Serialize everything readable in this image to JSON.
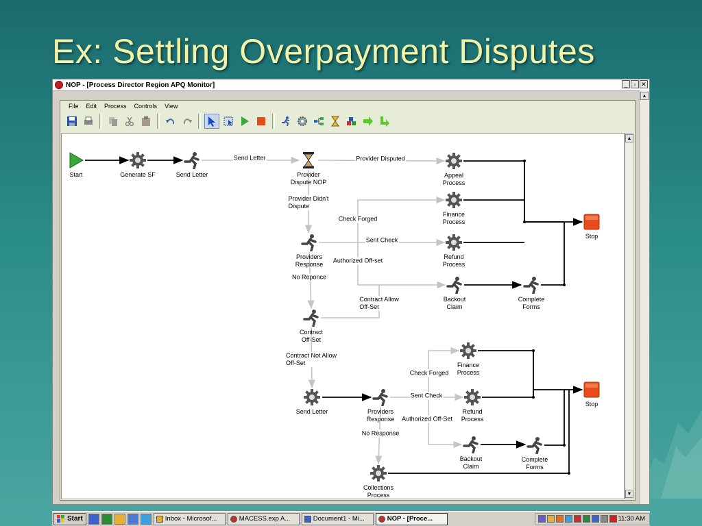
{
  "slide": {
    "title": "Ex: Settling Overpayment Disputes"
  },
  "window": {
    "title": "NOP - [Process Director Region APQ Monitor]"
  },
  "menu": {
    "items": [
      "File",
      "Edit",
      "Process",
      "Controls",
      "View"
    ]
  },
  "toolbar": {
    "groups": [
      [
        "save-icon",
        "print-icon"
      ],
      [
        "copy-icon",
        "cut-icon",
        "paste-icon"
      ],
      [
        "undo-icon",
        "redo-icon"
      ],
      [
        "pointer-icon",
        "select-area-icon",
        "start-node-icon",
        "stop-node-icon"
      ],
      [
        "task-runner-icon",
        "gear-icon",
        "connector-icon",
        "hourglass-icon",
        "cubes-icon",
        "arrow-right-icon",
        "arrow-corner-icon"
      ]
    ]
  },
  "diagram": {
    "nodes": [
      {
        "id": "start",
        "type": "start",
        "label": "Start"
      },
      {
        "id": "generate-sf",
        "type": "gear",
        "label": "Generate SF"
      },
      {
        "id": "send-letter-1",
        "type": "runner",
        "label": "Send Letter"
      },
      {
        "id": "provider-dispute-nop",
        "type": "hourglass",
        "label": "Provider\nDispute NOP"
      },
      {
        "id": "appeal-process",
        "type": "gear",
        "label": "Appeal\nProcess"
      },
      {
        "id": "finance-process-1",
        "type": "gear",
        "label": "Finance\nProcess"
      },
      {
        "id": "refund-process-1",
        "type": "gear",
        "label": "Refund\nProcess"
      },
      {
        "id": "providers-response-1",
        "type": "runner",
        "label": "Providers\nResponse"
      },
      {
        "id": "backout-claim-1",
        "type": "runner",
        "label": "Backout\nClaim"
      },
      {
        "id": "complete-forms-1",
        "type": "runner",
        "label": "Complete\nForms"
      },
      {
        "id": "stop-1",
        "type": "stop",
        "label": "Stop"
      },
      {
        "id": "contract-off-set",
        "type": "runner",
        "label": "Contract\nOff-Set"
      },
      {
        "id": "send-letter-2",
        "type": "gear",
        "label": "Send Letter"
      },
      {
        "id": "providers-response-2",
        "type": "runner",
        "label": "Providers\nResponse"
      },
      {
        "id": "finance-process-2",
        "type": "gear",
        "label": "Finance\nProcess"
      },
      {
        "id": "refund-process-2",
        "type": "gear",
        "label": "Refund\nProcess"
      },
      {
        "id": "backout-claim-2",
        "type": "runner",
        "label": "Backout\nClaim"
      },
      {
        "id": "complete-forms-2",
        "type": "runner",
        "label": "Complete\nForms"
      },
      {
        "id": "stop-2",
        "type": "stop",
        "label": "Stop"
      },
      {
        "id": "collections-process",
        "type": "gear",
        "label": "Collections\nProcess"
      }
    ],
    "edge_labels": [
      {
        "id": "send-letter",
        "text": "Send Letter"
      },
      {
        "id": "provider-disputed",
        "text": "Provider Disputed"
      },
      {
        "id": "provider-didnt-dispute",
        "text": "Provider Didn't\nDispute"
      },
      {
        "id": "check-forged-1",
        "text": "Check Forged"
      },
      {
        "id": "sent-check-1",
        "text": "Sent Check"
      },
      {
        "id": "authorized-off-set-1",
        "text": "Authorized Off-set"
      },
      {
        "id": "no-reponce",
        "text": "No Reponce"
      },
      {
        "id": "contract-allow-off-set",
        "text": "Contract Allow\nOff-Set"
      },
      {
        "id": "contract-not-allow-off-set",
        "text": "Contract Not Allow\nOff-Set"
      },
      {
        "id": "check-forged-2",
        "text": "Check Forged"
      },
      {
        "id": "sent-check-2",
        "text": "Sent Check"
      },
      {
        "id": "authorized-off-set-2",
        "text": "Authorized Off-Set"
      },
      {
        "id": "no-response",
        "text": "No Response"
      }
    ]
  },
  "taskbar": {
    "start_label": "Start",
    "quick_launch": [
      "word-icon",
      "excel-icon",
      "outlook-icon",
      "browser-icon",
      "ie-icon"
    ],
    "tasks": [
      {
        "label": "Inbox - Microsof...",
        "active": false
      },
      {
        "label": "MACESS.exp A...",
        "active": false
      },
      {
        "label": "Document1 - Mi...",
        "active": false
      },
      {
        "label": "NOP - [Proce...",
        "active": true
      }
    ],
    "tray_icons": [
      "tray-app-icon",
      "tray-network-icon",
      "tray-chat-icon",
      "tray-messenger-icon",
      "tray-shield-icon",
      "tray-sync-icon",
      "tray-globe-icon",
      "tray-mail-icon",
      "tray-n-icon"
    ],
    "clock": "11:30 AM"
  },
  "colors": {
    "start": "#3aa83a",
    "stop": "#e84a1a",
    "edge_active": "#000000",
    "edge_idle": "#c4c4c4"
  }
}
